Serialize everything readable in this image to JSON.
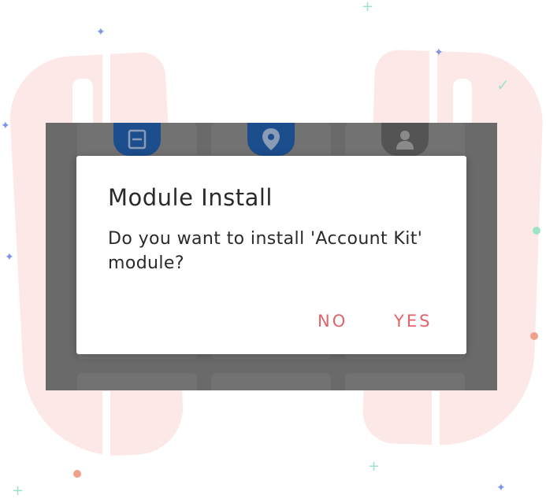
{
  "dialog": {
    "title": "Module Install",
    "message": "Do you want to install 'Account Kit' module?",
    "buttons": {
      "no": "NO",
      "yes": "YES"
    },
    "button_color": "#e2636a"
  },
  "background_tiles": {
    "icons": [
      "scanner-icon",
      "location-pin-icon",
      "account-icon"
    ]
  },
  "colors": {
    "scrim": "#6a6a6a",
    "tile_icon_blue": "#1c4d8c",
    "decor_pink": "#fde8e8"
  }
}
